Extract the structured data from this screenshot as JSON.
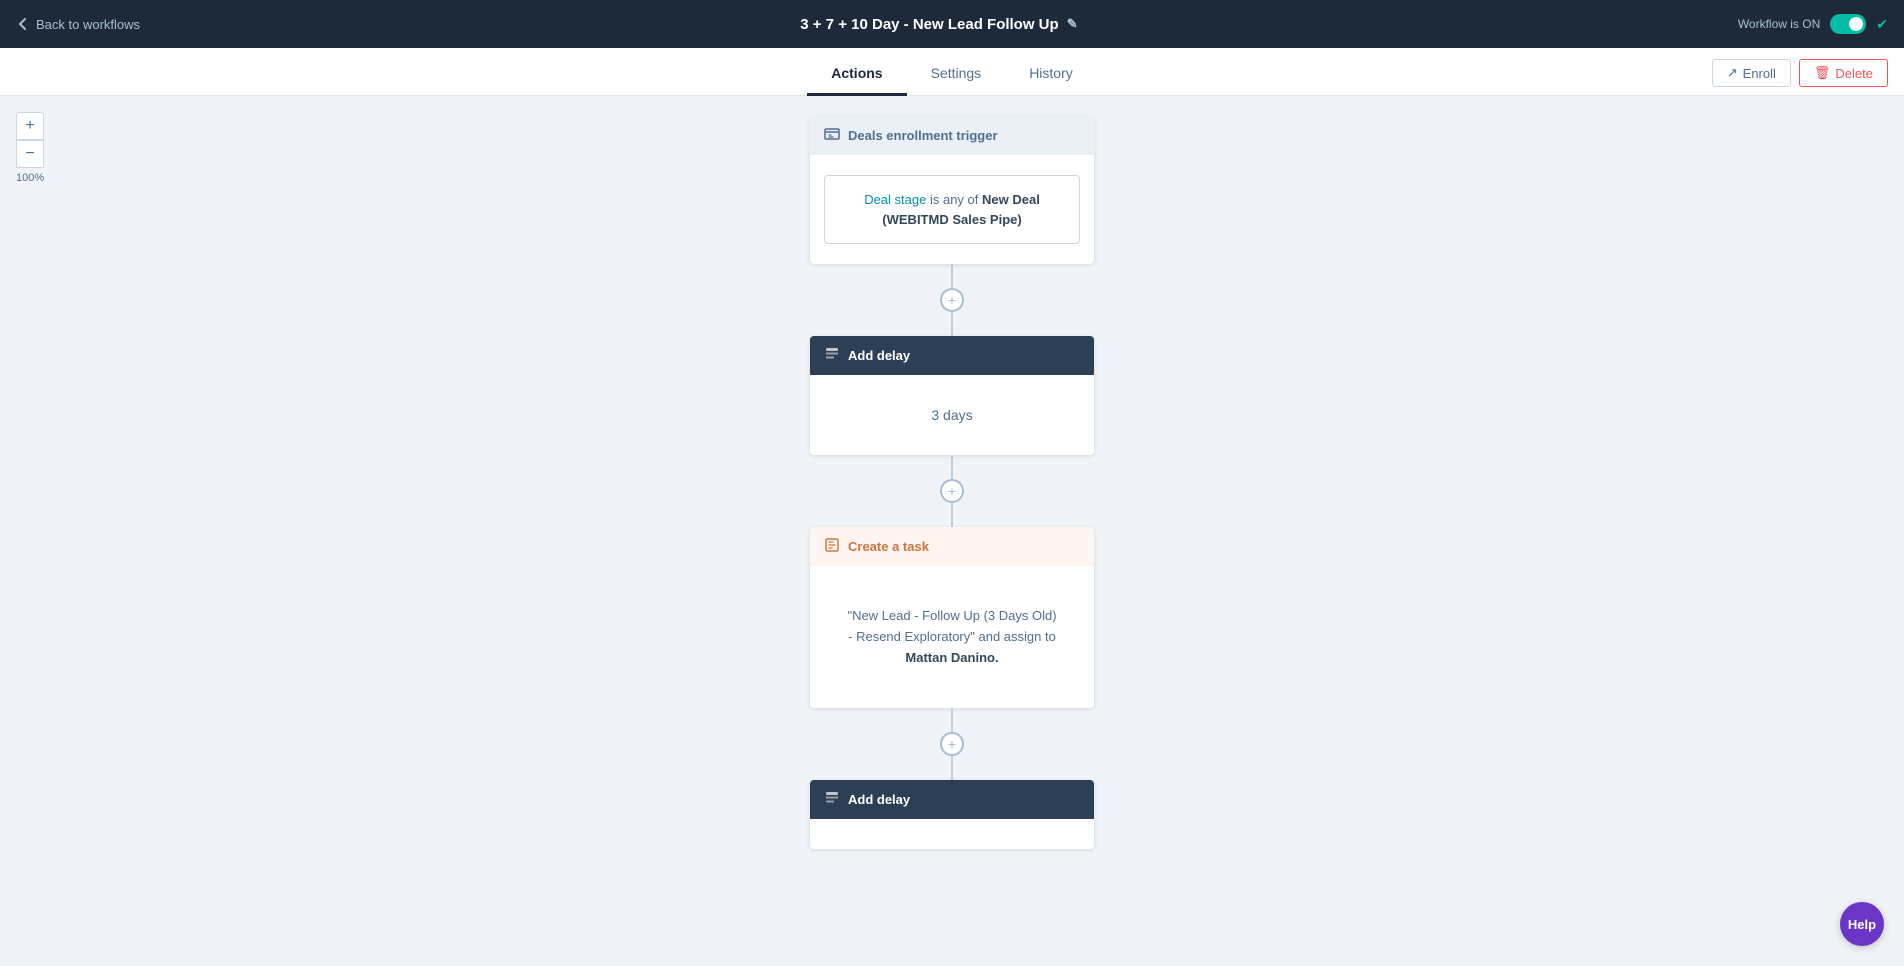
{
  "topbar": {
    "back_label": "Back to workflows",
    "title": "3 + 7 + 10 Day - New Lead Follow Up",
    "edit_tooltip": "Edit title",
    "workflow_status_label": "Workflow is ON"
  },
  "tabs": [
    {
      "id": "actions",
      "label": "Actions",
      "active": true
    },
    {
      "id": "settings",
      "label": "Settings",
      "active": false
    },
    {
      "id": "history",
      "label": "History",
      "active": false
    }
  ],
  "toolbar_buttons": {
    "enroll_label": "Enroll",
    "delete_label": "Delete"
  },
  "zoom": {
    "plus_label": "+",
    "minus_label": "−",
    "level": "100%"
  },
  "nodes": [
    {
      "id": "trigger",
      "type": "trigger",
      "header_icon": "deals-icon",
      "header_label": "Deals enrollment trigger",
      "body": {
        "condition_link": "Deal stage",
        "condition_text": " is any of ",
        "condition_value": "New Deal (WEBITMD Sales Pipe)"
      }
    },
    {
      "id": "delay1",
      "type": "delay",
      "header_icon": "delay-icon",
      "header_label": "Add delay",
      "body_value": "3 days"
    },
    {
      "id": "task1",
      "type": "task",
      "header_icon": "task-icon",
      "header_label": "Create a task",
      "body_quote": "\"New Lead - Follow Up (3 Days Old) - Resend Exploratory\"",
      "body_middle": " and assign to ",
      "body_bold": "Mattan Danino."
    },
    {
      "id": "delay2",
      "type": "delay",
      "header_icon": "delay-icon",
      "header_label": "Add delay",
      "body_value": ""
    }
  ],
  "help_label": "Help"
}
